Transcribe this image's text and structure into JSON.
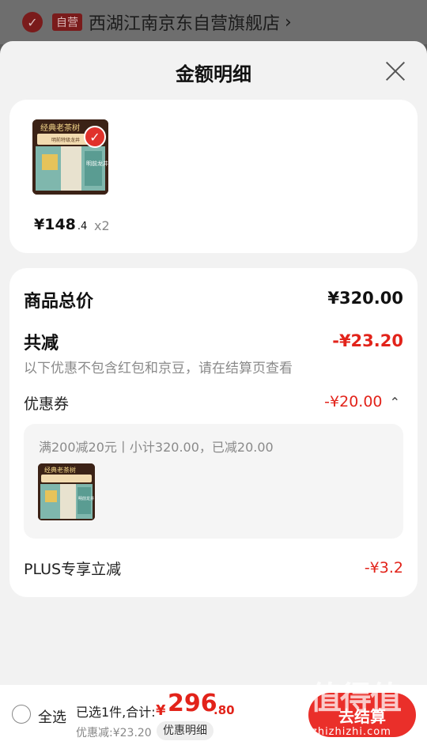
{
  "store": {
    "badge": "自营",
    "name": "西湖江南京东自营旗舰店",
    "chevron": "›"
  },
  "sheet": {
    "title": "金额明细"
  },
  "product": {
    "image_title": "经典老茶树",
    "image_subtitle": "明前特级龙井",
    "image_side": "明前龙井",
    "price_int": "¥148",
    "price_dec": ".4",
    "qty": "x2"
  },
  "detail": {
    "goods_total_label": "商品总价",
    "goods_total_value": "¥320.00",
    "reduce_label": "共减",
    "reduce_value": "-¥23.20",
    "reduce_note": "以下优惠不包含红包和京豆，请在结算页查看",
    "coupon_label": "优惠券",
    "coupon_value": "-¥20.00",
    "coupon_chevron": "⌃",
    "coupon_desc": "满200减20元丨小计320.00，已减20.00",
    "plus_label": "PLUS专享立减",
    "plus_value": "-¥3.2"
  },
  "bottom": {
    "select_all": "全选",
    "selected_text": "已选1件,合计:",
    "total_yen": "¥",
    "total_int": "296",
    "total_dec": ".80",
    "discount_text": "优惠减:¥23.20",
    "detail_chip": "优惠明细",
    "checkout": "去结算"
  },
  "watermark": {
    "main": "值得值",
    "sub": "zhizhizhi.com"
  },
  "colors": {
    "accent": "#e2231a",
    "checkout": "#ea2f2a"
  }
}
